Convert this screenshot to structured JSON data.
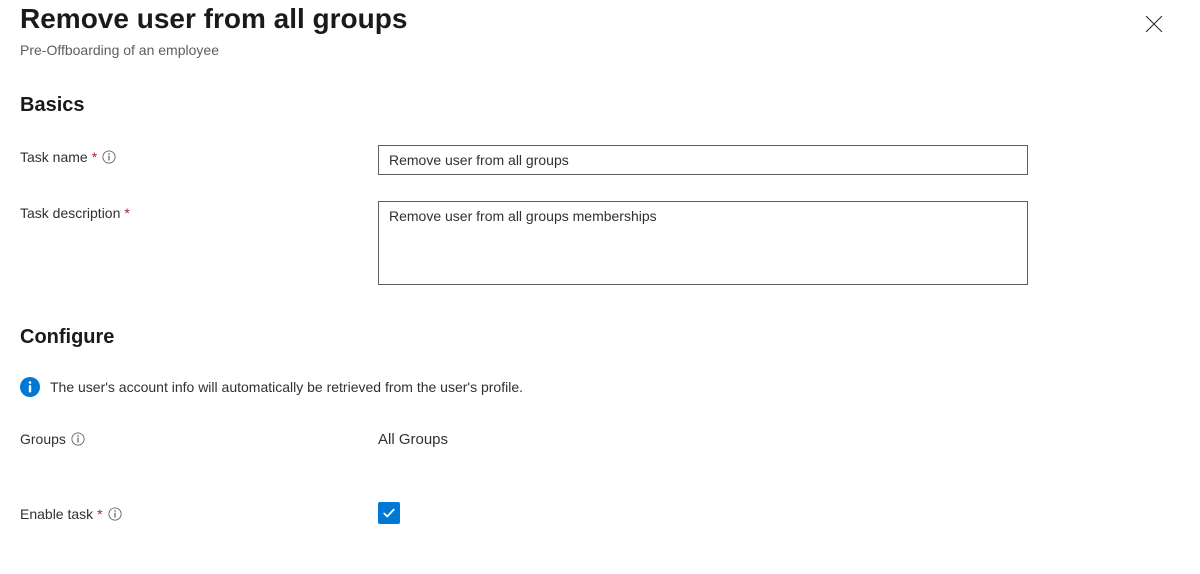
{
  "header": {
    "title": "Remove user from all groups",
    "subtitle": "Pre-Offboarding of an employee"
  },
  "sections": {
    "basics": {
      "heading": "Basics",
      "task_name": {
        "label": "Task name",
        "value": "Remove user from all groups"
      },
      "task_description": {
        "label": "Task description",
        "value": "Remove user from all groups memberships"
      }
    },
    "configure": {
      "heading": "Configure",
      "banner": "The user's account info will automatically be retrieved from the user's profile.",
      "groups": {
        "label": "Groups",
        "value": "All Groups"
      },
      "enable_task": {
        "label": "Enable task",
        "checked": true
      }
    }
  }
}
